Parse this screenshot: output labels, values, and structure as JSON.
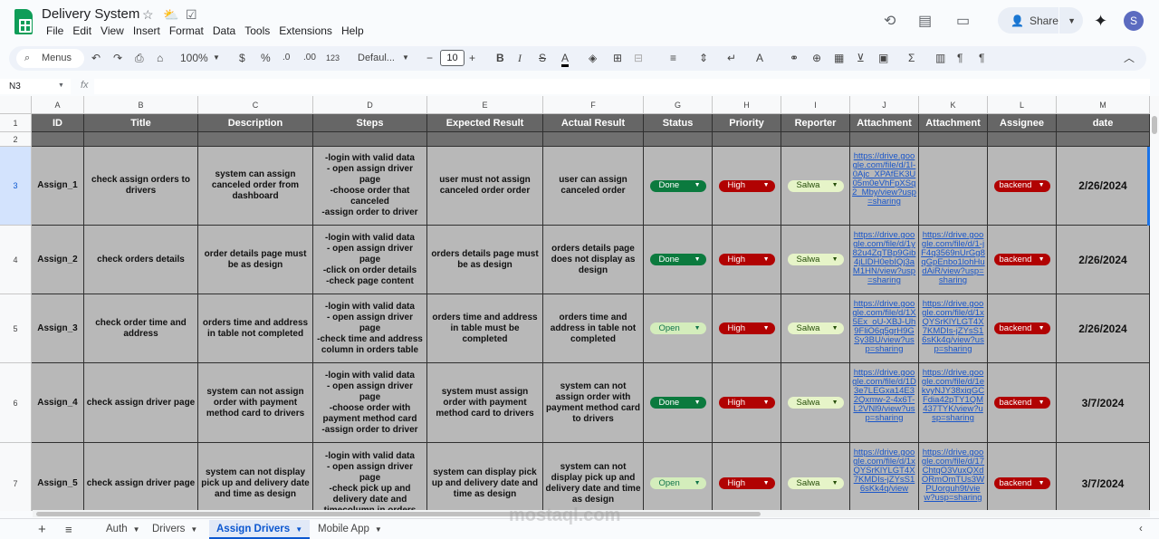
{
  "app": {
    "title": "Delivery System",
    "menus": [
      "File",
      "Edit",
      "View",
      "Insert",
      "Format",
      "Data",
      "Tools",
      "Extensions",
      "Help"
    ],
    "share_label": "Share",
    "avatar_letter": "S"
  },
  "toolbar": {
    "menus_label": "Menus",
    "zoom": "100%",
    "currency": "$",
    "percent": "%",
    "dec_dec": ".0",
    "dec_inc": ".00",
    "number_format": "123",
    "font": "Defaul...",
    "font_size": "10"
  },
  "formula": {
    "cell_ref": "N3",
    "fx": "fx"
  },
  "columns": [
    "A",
    "B",
    "C",
    "D",
    "E",
    "F",
    "G",
    "H",
    "I",
    "J",
    "K",
    "L",
    "M"
  ],
  "row_numbers": [
    "1",
    "2",
    "3",
    "4",
    "5",
    "6",
    "7"
  ],
  "headers": [
    "ID",
    "Title",
    "Description",
    "Steps",
    "Expected Result",
    "Actual Result",
    "Status",
    "Priority",
    "Reporter",
    "Attachment",
    "Attachment",
    "Assignee",
    "date"
  ],
  "rows": [
    {
      "id": "Assign_1",
      "title": "check assign orders to drivers",
      "description": "system can assign canceled order from dashboard",
      "steps": "-login with valid data\n- open assign driver page\n-choose order that canceled\n-assign order to driver",
      "expected": "user must not assign canceled order order",
      "actual": "user can assign canceled order",
      "status": "Done",
      "priority": "High",
      "reporter": "Salwa",
      "att1": "https://drive.google.com/file/d/1I-0Ajc_XPAfEK3U05m0eVhFpXSq2_Mby/view?usp=sharing",
      "att2": "",
      "assignee": "backend",
      "date": "2/26/2024"
    },
    {
      "id": "Assign_2",
      "title": "check orders details",
      "description": "order details page must be as design",
      "steps": "-login with valid data\n- open assign driver page\n-click on order details\n-check page content",
      "expected": "orders details page must be as design",
      "actual": "orders details page does not display  as design",
      "status": "Done",
      "priority": "High",
      "reporter": "Salwa",
      "att1": "https://drive.google.com/file/d/1y82u4ZqTBp9Gib4jLlDH0ebIQj3aM1HN/view?usp=sharing",
      "att2": "https://drive.google.com/file/d/1-jF4q3569nUrGg8qGpEnbo1lohHudAiR/view?usp=sharing",
      "assignee": "backend",
      "date": "2/26/2024"
    },
    {
      "id": "Assign_3",
      "title": "check order time and address",
      "description": "orders time and address in table  not completed",
      "steps": "-login with valid data\n- open assign driver page\n-check time and address column in orders table",
      "expected": "orders time and address in table  must be completed",
      "actual": "orders time and address in table  not completed",
      "status": "Open",
      "priority": "High",
      "reporter": "Salwa",
      "att1": "https://drive.google.com/file/d/1X5Ex_oU-XBJ-Uh9FliO6q5grH9GSy3BU/view?usp=sharing",
      "att2": "https://drive.google.com/file/d/1xQYSrKlYLGT4X7KMDIs-jZYsS16sKk4q/view?usp=sharing",
      "assignee": "backend",
      "date": "2/26/2024"
    },
    {
      "id": "Assign_4",
      "title": "check assign driver page",
      "description": "system can not assign order with payment method card to drivers",
      "steps": "-login with valid data\n- open assign driver page\n-choose order with payment method card\n-assign order to driver",
      "expected": "system must assign order with payment method card to drivers",
      "actual": "system can not assign order with payment method card to drivers",
      "status": "Done",
      "priority": "High",
      "reporter": "Salwa",
      "att1": "https://drive.google.com/file/d/1D3e7LEGxa14E32Qxmw-2-4x6T-L2VNl9/view?usp=sharing",
      "att2": "https://drive.google.com/file/d/1ekvyNJY38xiqGCFdia42pTY1QM437TYK/view?usp=sharing",
      "assignee": "backend",
      "date": "3/7/2024"
    },
    {
      "id": "Assign_5",
      "title": "check assign driver page",
      "description": "system can not display pick up and delivery date and time as design",
      "steps": "-login with valid data\n- open assign driver page\n-check pick up and delivery date and timecolumn in orders",
      "expected": "system can display pick up and delivery date and time as design",
      "actual": "system can not display pick up and delivery date and time as design",
      "status": "Open",
      "priority": "High",
      "reporter": "Salwa",
      "att1": "https://drive.google.com/file/d/1xQYSrKlYLGT4X7KMDIs-jZYsS16sKk4q/view",
      "att2": "https://drive.google.com/file/d/17ChtqO3VuxQXdORmOmTUs3WPUorguh9t/view?usp=sharing",
      "assignee": "backend",
      "date": "3/7/2024"
    }
  ],
  "sheets": [
    "Auth",
    "Drivers",
    "Assign Drivers",
    "Mobile App"
  ],
  "active_sheet": "Assign Drivers",
  "watermark": "mostaql.com",
  "colors": {
    "header_bg": "#666666",
    "cell_bg": "#b8b8b8",
    "done": "#0b7a3e",
    "open": "#d4edbc",
    "high": "#b10202",
    "accent": "#0b57d0"
  }
}
